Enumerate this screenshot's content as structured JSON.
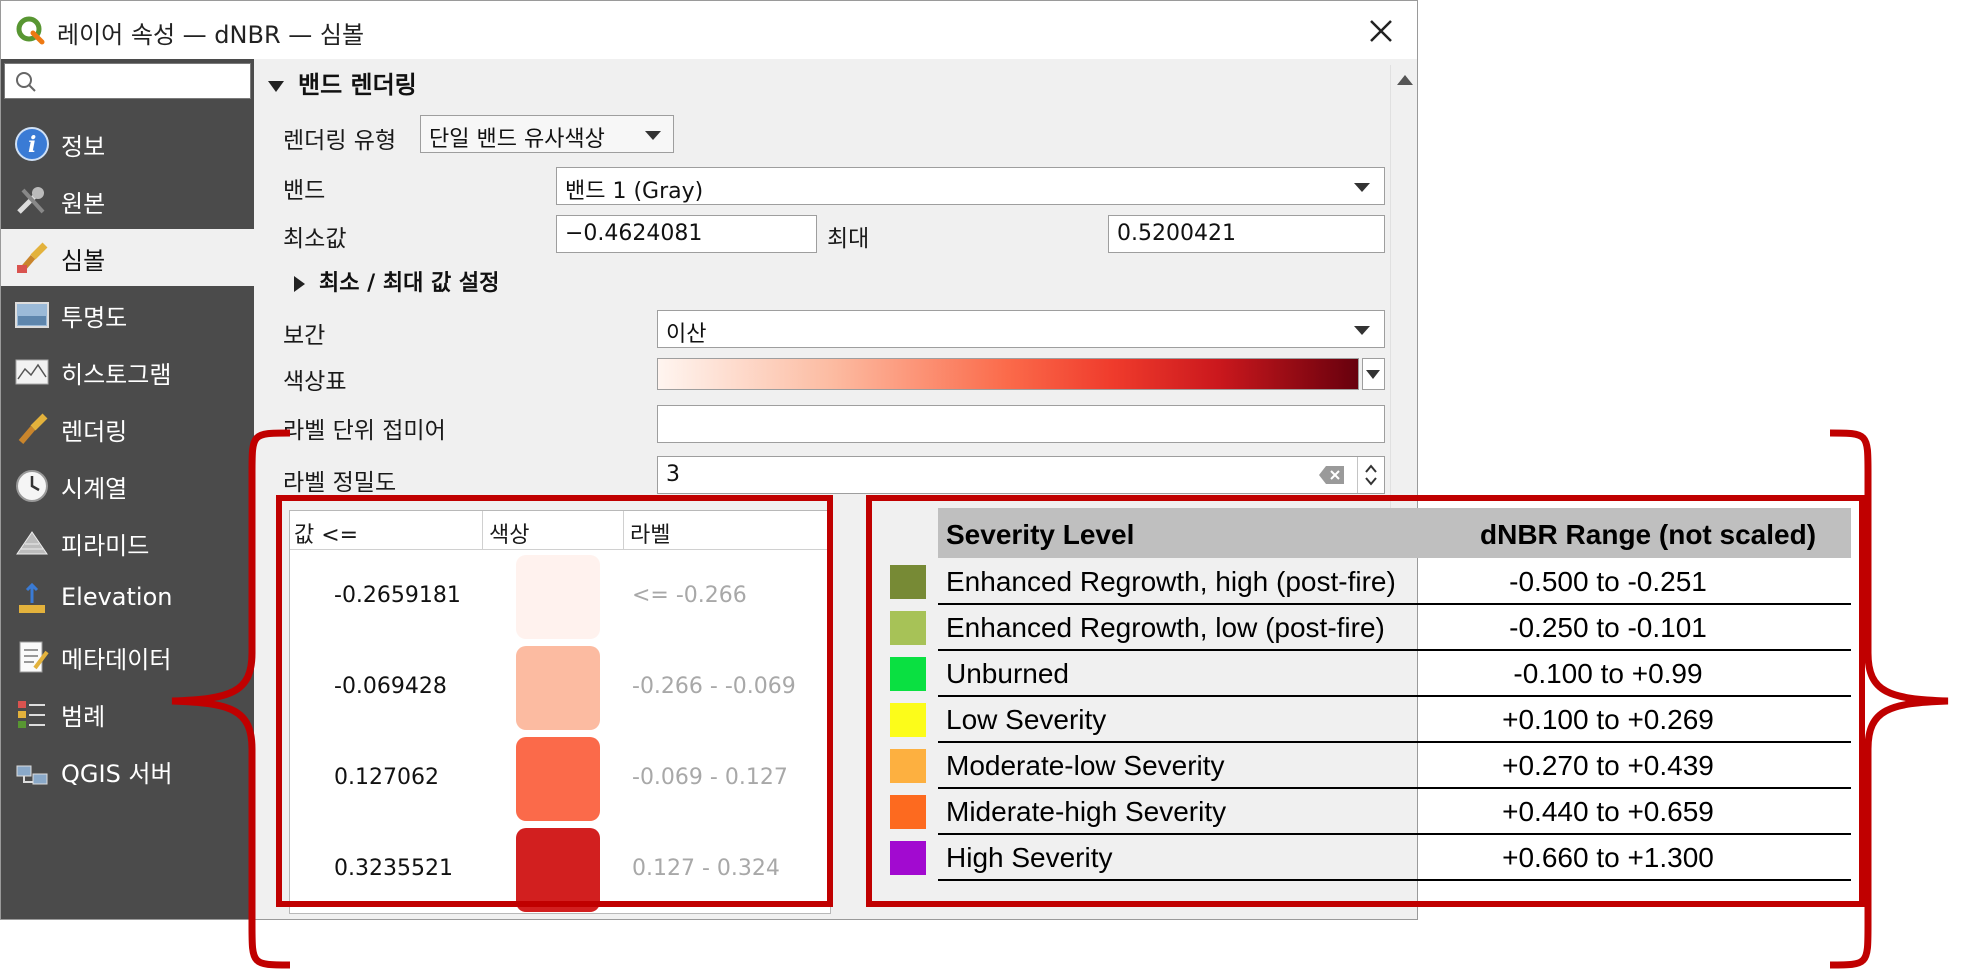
{
  "window": {
    "title": "레이어 속성 — dNBR — 심볼"
  },
  "sidebar": {
    "search_placeholder": "",
    "items": [
      {
        "label": "정보",
        "icon": "info-icon",
        "active": false
      },
      {
        "label": "원본",
        "icon": "source-tools-icon",
        "active": false
      },
      {
        "label": "심볼",
        "icon": "symbology-brush-icon",
        "active": true
      },
      {
        "label": "투명도",
        "icon": "transparency-icon",
        "active": false
      },
      {
        "label": "히스토그램",
        "icon": "histogram-icon",
        "active": false
      },
      {
        "label": "렌더링",
        "icon": "rendering-brush-icon",
        "active": false
      },
      {
        "label": "시계열",
        "icon": "clock-icon",
        "active": false
      },
      {
        "label": "피라미드",
        "icon": "pyramid-icon",
        "active": false
      },
      {
        "label": "Elevation",
        "icon": "elevation-icon",
        "active": false
      },
      {
        "label": "메타데이터",
        "icon": "metadata-icon",
        "active": false
      },
      {
        "label": "범례",
        "icon": "legend-icon",
        "active": false
      },
      {
        "label": "QGIS 서버",
        "icon": "server-icon",
        "active": false
      }
    ]
  },
  "band_render": {
    "section_title": "밴드 렌더링",
    "render_type_label": "렌더링 유형",
    "render_type_value": "단일 밴드 유사색상",
    "band_label": "밴드",
    "band_value": "밴드 1 (Gray)",
    "min_label": "최소값",
    "min_value": "−0.4624081",
    "max_label": "최대",
    "max_value": "0.5200421",
    "minmax_section": "최소 / 최대 값 설정",
    "interp_label": "보간",
    "interp_value": "이산",
    "ramp_label": "색상표",
    "suffix_label": "라벨 단위 접미어",
    "suffix_value": "",
    "precision_label": "라벨 정밀도",
    "precision_value": "3"
  },
  "class_table": {
    "headers": [
      "값 <=",
      "색상",
      "라벨"
    ],
    "rows": [
      {
        "value": "-0.2659181",
        "color": "#fff2ee",
        "label": "<= -0.266"
      },
      {
        "value": "-0.069428",
        "color": "#fcbba1",
        "label": "-0.266 - -0.069"
      },
      {
        "value": "0.127062",
        "color": "#fb6a4a",
        "label": "-0.069 - 0.127"
      },
      {
        "value": "0.3235521",
        "color": "#d21f1f",
        "label": "0.127 - 0.324"
      }
    ]
  },
  "severity_table": {
    "header_level": "Severity Level",
    "header_range": "dNBR Range (not scaled)",
    "rows": [
      {
        "level": "Enhanced Regrowth, high (post-fire)",
        "range": "-0.500 to -0.251",
        "color": "#778a35"
      },
      {
        "level": "Enhanced Regrowth, low (post-fire)",
        "range": "-0.250 to -0.101",
        "color": "#a7c257"
      },
      {
        "level": "Unburned",
        "range": "-0.100 to +0.99",
        "color": "#0ae041"
      },
      {
        "level": "Low Severity",
        "range": "+0.100 to +0.269",
        "color": "#fcfc1a"
      },
      {
        "level": "Moderate-low Severity",
        "range": "+0.270 to +0.439",
        "color": "#fdb040"
      },
      {
        "level": "Miderate-high Severity",
        "range": "+0.440 to +0.659",
        "color": "#fd6a1f"
      },
      {
        "level": "High Severity",
        "range": "+0.660 to +1.300",
        "color": "#a20ad0"
      }
    ]
  },
  "colors": {
    "highlight": "#c00000",
    "sidebar_bg": "#4b4b4b",
    "qgis_green": "#589632"
  }
}
